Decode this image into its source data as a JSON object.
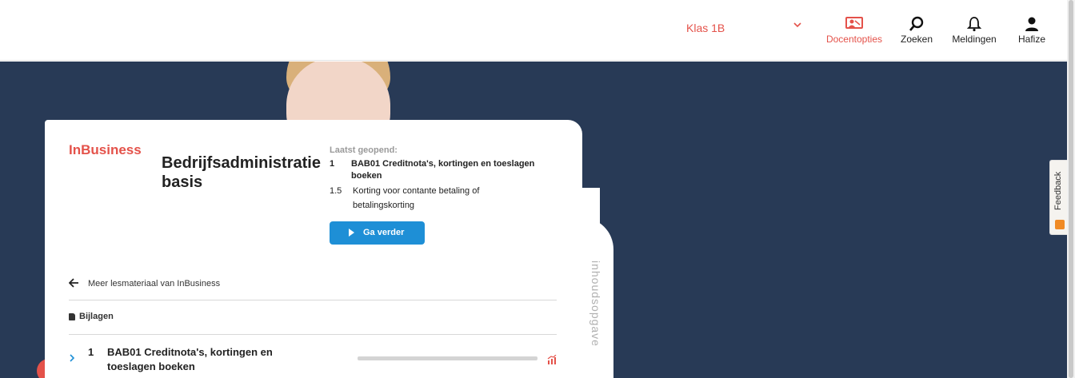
{
  "header": {
    "class_select": {
      "value": "Klas 1B"
    },
    "nav": [
      {
        "label": "Docentopties",
        "icon": "teacher-board-icon",
        "active": true
      },
      {
        "label": "Zoeken",
        "icon": "search-icon"
      },
      {
        "label": "Meldingen",
        "icon": "bell-icon"
      },
      {
        "label": "Hafize",
        "icon": "user-icon"
      }
    ]
  },
  "colors": {
    "accent": "#e4524a",
    "primary_button": "#1e8fd6",
    "hero_bg": "#283a56"
  },
  "course": {
    "publisher_logo_text": "InBusiness",
    "title": "Bedrijfsadministratie basis",
    "last_opened_label": "Laatst geopend:",
    "last_chapter_num": "1",
    "last_chapter_title": "BAB01 Creditnota's, kortingen en toeslagen boeken",
    "last_section_num": "1.5",
    "last_section_title": "Korting voor contante betaling of betalingskorting",
    "continue_button": "Ga verder",
    "more_link": "Meer lesmateriaal van InBusiness",
    "attachments_label": "Bijlagen",
    "toc_tab_label": "inhoudsopgave"
  },
  "chapters": [
    {
      "num": "1",
      "title": "BAB01 Creditnota's, kortingen en toeslagen boeken",
      "progress": 0.0
    }
  ],
  "feedback": {
    "label": "Feedback"
  }
}
